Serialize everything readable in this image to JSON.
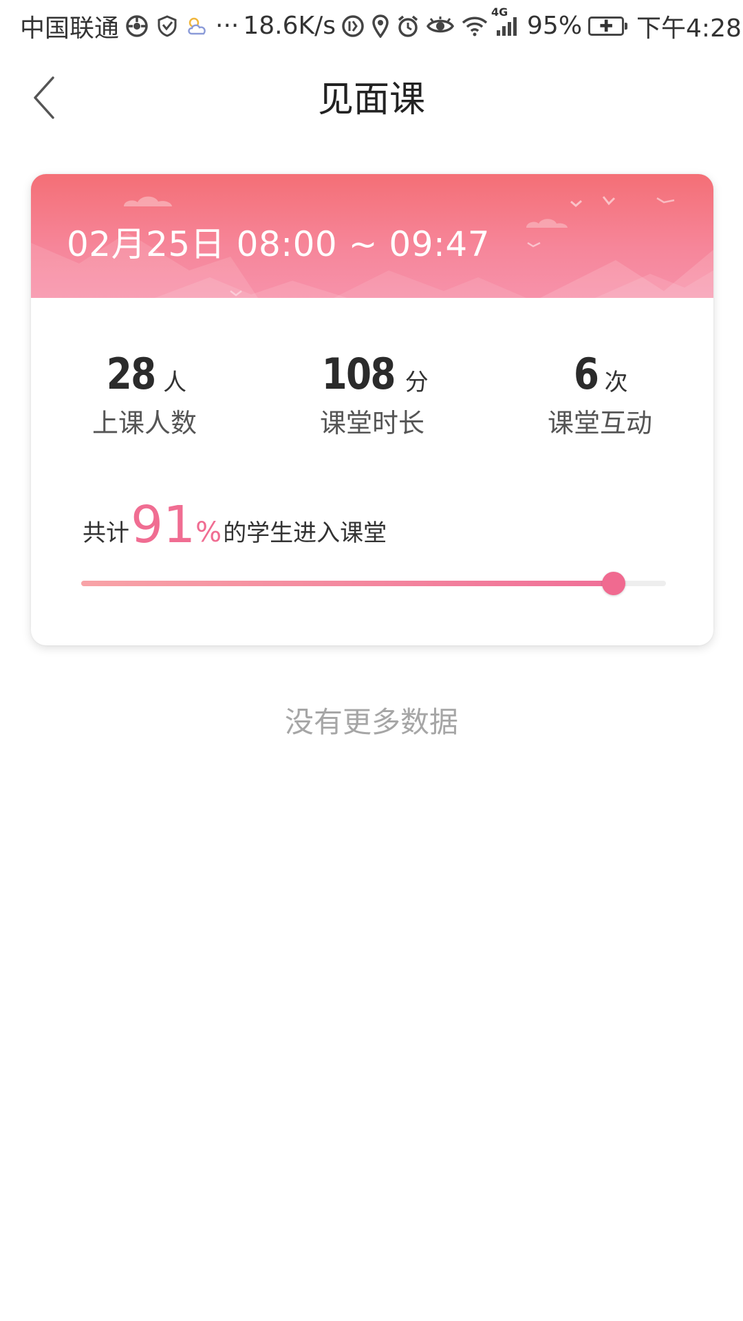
{
  "status_bar": {
    "carrier": "中国联通",
    "ellipsis": "···",
    "net_speed": "18.6K/s",
    "network_type": "4G",
    "battery_percent": "95%",
    "time": "下午4:28",
    "icons": [
      "app-icon",
      "shield-icon",
      "weather-icon",
      "data-saver-icon",
      "location-icon",
      "alarm-icon",
      "eye-icon",
      "wifi-icon",
      "signal-icon",
      "battery-icon"
    ]
  },
  "nav": {
    "title": "见面课",
    "back_icon": "chevron-left-icon"
  },
  "session": {
    "time_range": "02月25日 08:00 ~ 09:47",
    "stats": [
      {
        "value": "28",
        "unit": "人",
        "label": "上课人数"
      },
      {
        "value": "108",
        "unit": "分",
        "label": "课堂时长"
      },
      {
        "value": "6",
        "unit": "次",
        "label": "课堂互动"
      }
    ],
    "attendance": {
      "prefix": "共计",
      "percent": "91",
      "percent_sign": "%",
      "suffix": "的学生进入课堂",
      "progress_fraction": 0.91
    }
  },
  "footer": {
    "no_more_text": "没有更多数据"
  },
  "colors": {
    "accent": "#f06d92",
    "header_gradient_top": "#f46f76",
    "header_gradient_bottom": "#f792aa"
  }
}
